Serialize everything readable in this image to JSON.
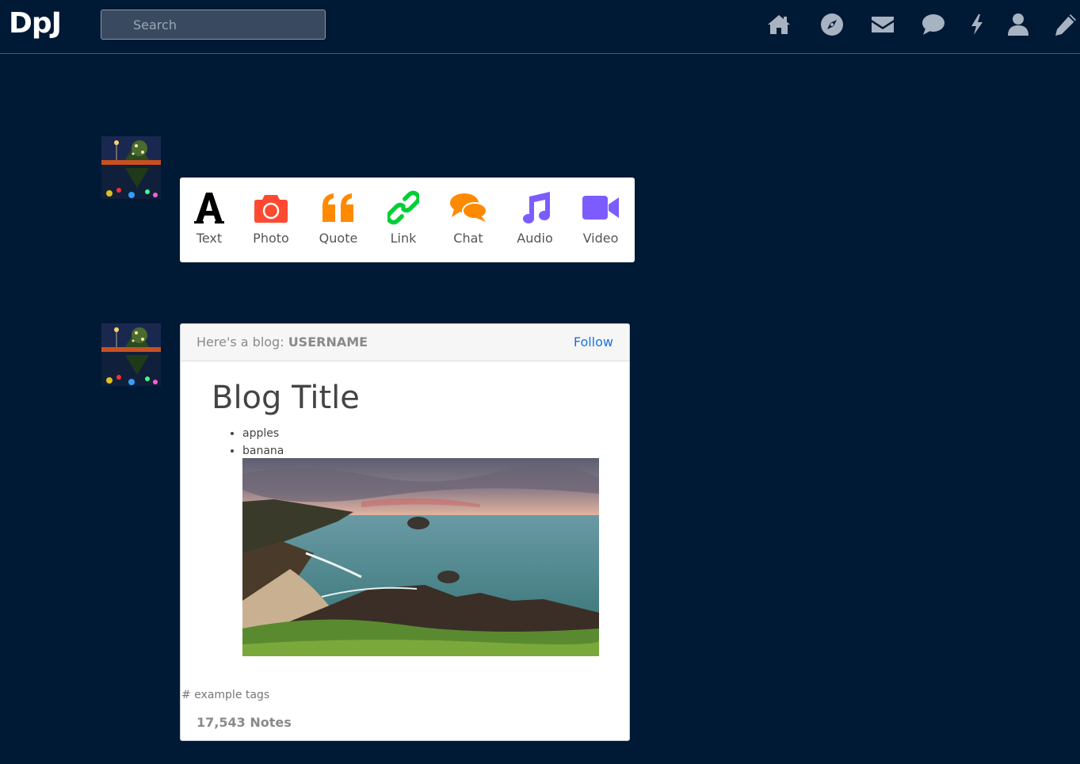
{
  "header": {
    "logo": "DpJ",
    "search_placeholder": "Search",
    "nav_icons": [
      "home-icon",
      "compass-icon",
      "mail-icon",
      "chat-bubble-icon",
      "lightning-icon",
      "user-icon",
      "pencil-icon"
    ]
  },
  "post_types": [
    {
      "label": "Text",
      "icon": "text-icon",
      "color": "#000000"
    },
    {
      "label": "Photo",
      "icon": "camera-icon",
      "color": "#ff4930"
    },
    {
      "label": "Quote",
      "icon": "quote-icon",
      "color": "#ff8a00"
    },
    {
      "label": "Link",
      "icon": "link-icon",
      "color": "#00cf35"
    },
    {
      "label": "Chat",
      "icon": "chat-icon",
      "color": "#ff8a00"
    },
    {
      "label": "Audio",
      "icon": "music-icon",
      "color": "#7c5cff"
    },
    {
      "label": "Video",
      "icon": "video-icon",
      "color": "#7c5cff"
    }
  ],
  "post": {
    "header_prefix": "Here's a blog:",
    "username": "USERNAME",
    "follow_label": "Follow",
    "title": "Blog Title",
    "list_items": [
      "apples",
      "banana"
    ],
    "tags": "# example tags",
    "notes": "17,543 Notes"
  },
  "colors": {
    "background": "#001935",
    "link": "#1a73d9"
  }
}
